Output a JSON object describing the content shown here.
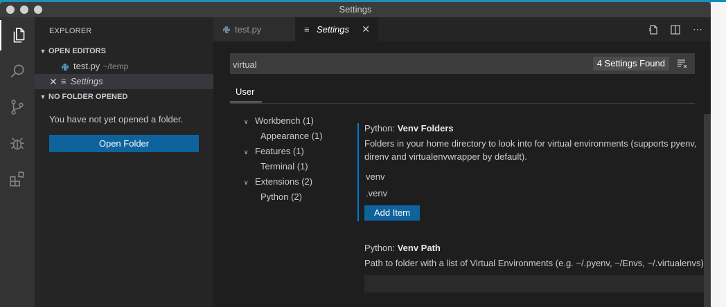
{
  "window": {
    "title": "Settings"
  },
  "sidebar": {
    "title": "EXPLORER",
    "open_editors": {
      "header": "OPEN EDITORS",
      "items": [
        {
          "name": "test.py",
          "desc": "~/temp"
        },
        {
          "name": "Settings",
          "desc": ""
        }
      ]
    },
    "no_folder": {
      "header": "NO FOLDER OPENED",
      "message": "You have not yet opened a folder.",
      "button": "Open Folder"
    }
  },
  "tabs": [
    {
      "label": "test.py"
    },
    {
      "label": "Settings"
    }
  ],
  "search": {
    "value": "virtual",
    "found": "4 Settings Found"
  },
  "scope": {
    "tab": "User"
  },
  "toc": [
    {
      "label": "Workbench (1)",
      "level": 0
    },
    {
      "label": "Appearance (1)",
      "level": 1
    },
    {
      "label": "Features (1)",
      "level": 0
    },
    {
      "label": "Terminal (1)",
      "level": 1
    },
    {
      "label": "Extensions (2)",
      "level": 0
    },
    {
      "label": "Python (2)",
      "level": 1
    }
  ],
  "settings": {
    "venv_folders": {
      "category": "Python: ",
      "name": "Venv Folders",
      "desc": "Folders in your home directory to look into for virtual environments (supports pyenv, direnv and virtualenvwrapper by default).",
      "items": [
        "venv",
        ".venv"
      ],
      "add_button": "Add Item"
    },
    "venv_path": {
      "category": "Python: ",
      "name": "Venv Path",
      "desc": "Path to folder with a list of Virtual Environments (e.g. ~/.pyenv, ~/Envs, ~/.virtualenvs).",
      "value": ""
    }
  },
  "colors": {
    "accent": "#007acc",
    "button": "#0e639c",
    "editor_bg": "#1e1e1e",
    "sidebar_bg": "#252526",
    "activity_bg": "#333333"
  }
}
